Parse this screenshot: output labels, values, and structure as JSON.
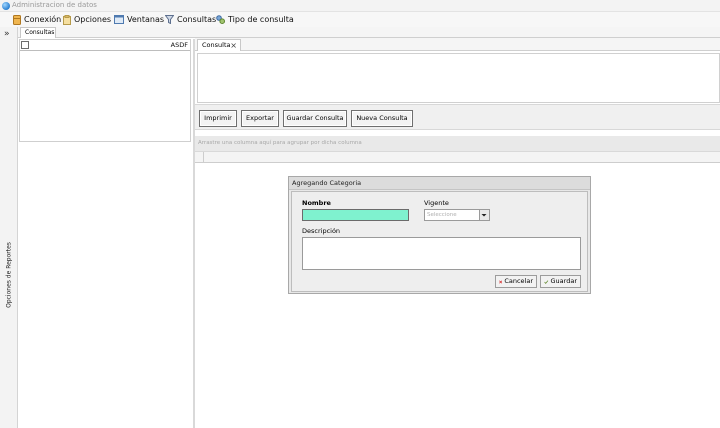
{
  "window": {
    "title": "Administracion de datos"
  },
  "menu": {
    "conexion": "Conexión",
    "opciones": "Opciones",
    "ventanas": "Ventanas",
    "consultas": "Consultas",
    "tipo_consulta": "Tipo de consulta"
  },
  "left": {
    "tab_label": "Consultas",
    "filter_value": "ASDF",
    "rail_label": "Opciones de Reportes"
  },
  "right": {
    "tab_label": "Consulta",
    "buttons": {
      "imprimir": "Imprimir",
      "exportar": "Exportar",
      "guardar_consulta": "Guardar Consulta",
      "nueva_consulta": "Nueva Consulta"
    },
    "group_hint": "Arrastre una columna aquí para agrupar por dicha columna"
  },
  "dialog": {
    "title": "Agregando Categoria",
    "nombre_label": "Nombre",
    "nombre_value": "",
    "vigente_label": "Vigente",
    "vigente_placeholder": "Seleccione",
    "descripcion_label": "Descripción",
    "descripcion_value": "",
    "cancelar": "Cancelar",
    "guardar": "Guardar"
  },
  "colors": {
    "nombre_field_bg": "#7ff2cf",
    "cancel_icon": "#d42020",
    "guardar_icon": "#6a8f3a"
  },
  "icons": [
    "app-icon",
    "db-icon",
    "options-icon",
    "windows-icon",
    "filter-icon",
    "query-type-icon",
    "cancel-x-icon",
    "check-icon",
    "close-icon",
    "chevron-right-icon"
  ]
}
